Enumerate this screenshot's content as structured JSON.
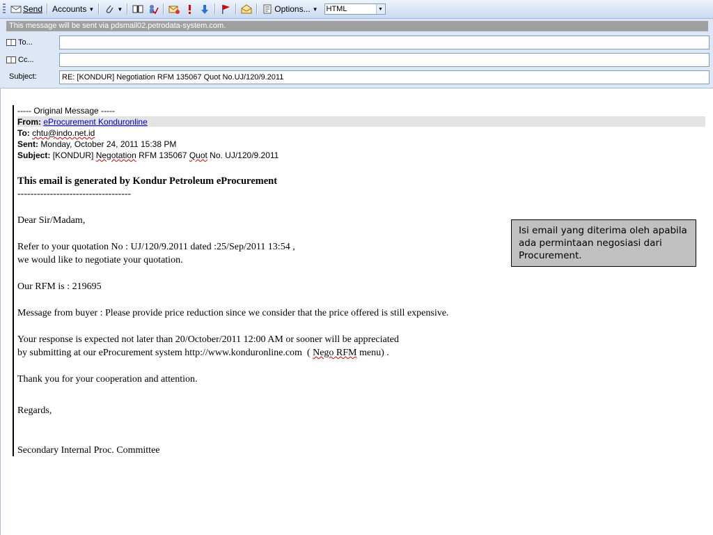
{
  "toolbar": {
    "send": "Send",
    "accounts": "Accounts",
    "options": "Options...",
    "format": "HTML"
  },
  "header": {
    "info": "This message will be sent via pdsmail02.petrodata-system.com.",
    "to_label": "To...",
    "to_value": "",
    "cc_label": "Cc...",
    "cc_value": "",
    "subject_label": "Subject:",
    "subject_value": "RE: [KONDUR] Negotiation RFM 135067 Quot No.UJ/120/9.2011"
  },
  "original": {
    "marker": "----- Original Message -----",
    "from_label": "From:",
    "from_value": "eProcurement Konduronline",
    "to_label": "To:",
    "to_value": "chtu@indo.net.id",
    "sent_label": "Sent:",
    "sent_value": "Monday, October 24, 2011 15:38 PM",
    "subject_label": "Subject:",
    "subject_a": "[KONDUR]",
    "subject_b": "Negotation",
    "subject_c": "RFM 135067",
    "subject_d": "Quot",
    "subject_e": "No. UJ/120/9.2011"
  },
  "body": {
    "heading": "This email is generated by Kondur Petroleum eProcurement",
    "rule": "-----------------------------------",
    "greeting": "Dear Sir/Madam,",
    "line1": "Refer to your quotation No : UJ/120/9.2011 dated :25/Sep/2011 13:54 ,",
    "line2": "we would like to negotiate your quotation.",
    "rfm": "Our RFM is : 219695",
    "message": "Message from buyer : Please provide price reduction since we consider that the price offered is still expensive.",
    "response1": "Your response is expected not later than  20/October/2011 12:00 AM or sooner will be appreciated",
    "response2a": "by submitting at our eProcurement system http://www.konduronline.com  ( ",
    "response2b": "Nego RFM",
    "response2c": " menu) .",
    "thanks": "Thank you for your cooperation and attention.",
    "regards": "Regards,",
    "signature": "Secondary Internal Proc. Committee"
  },
  "annotation": "Isi email yang diterima oleh apabila ada permintaan negosiasi dari Procurement."
}
